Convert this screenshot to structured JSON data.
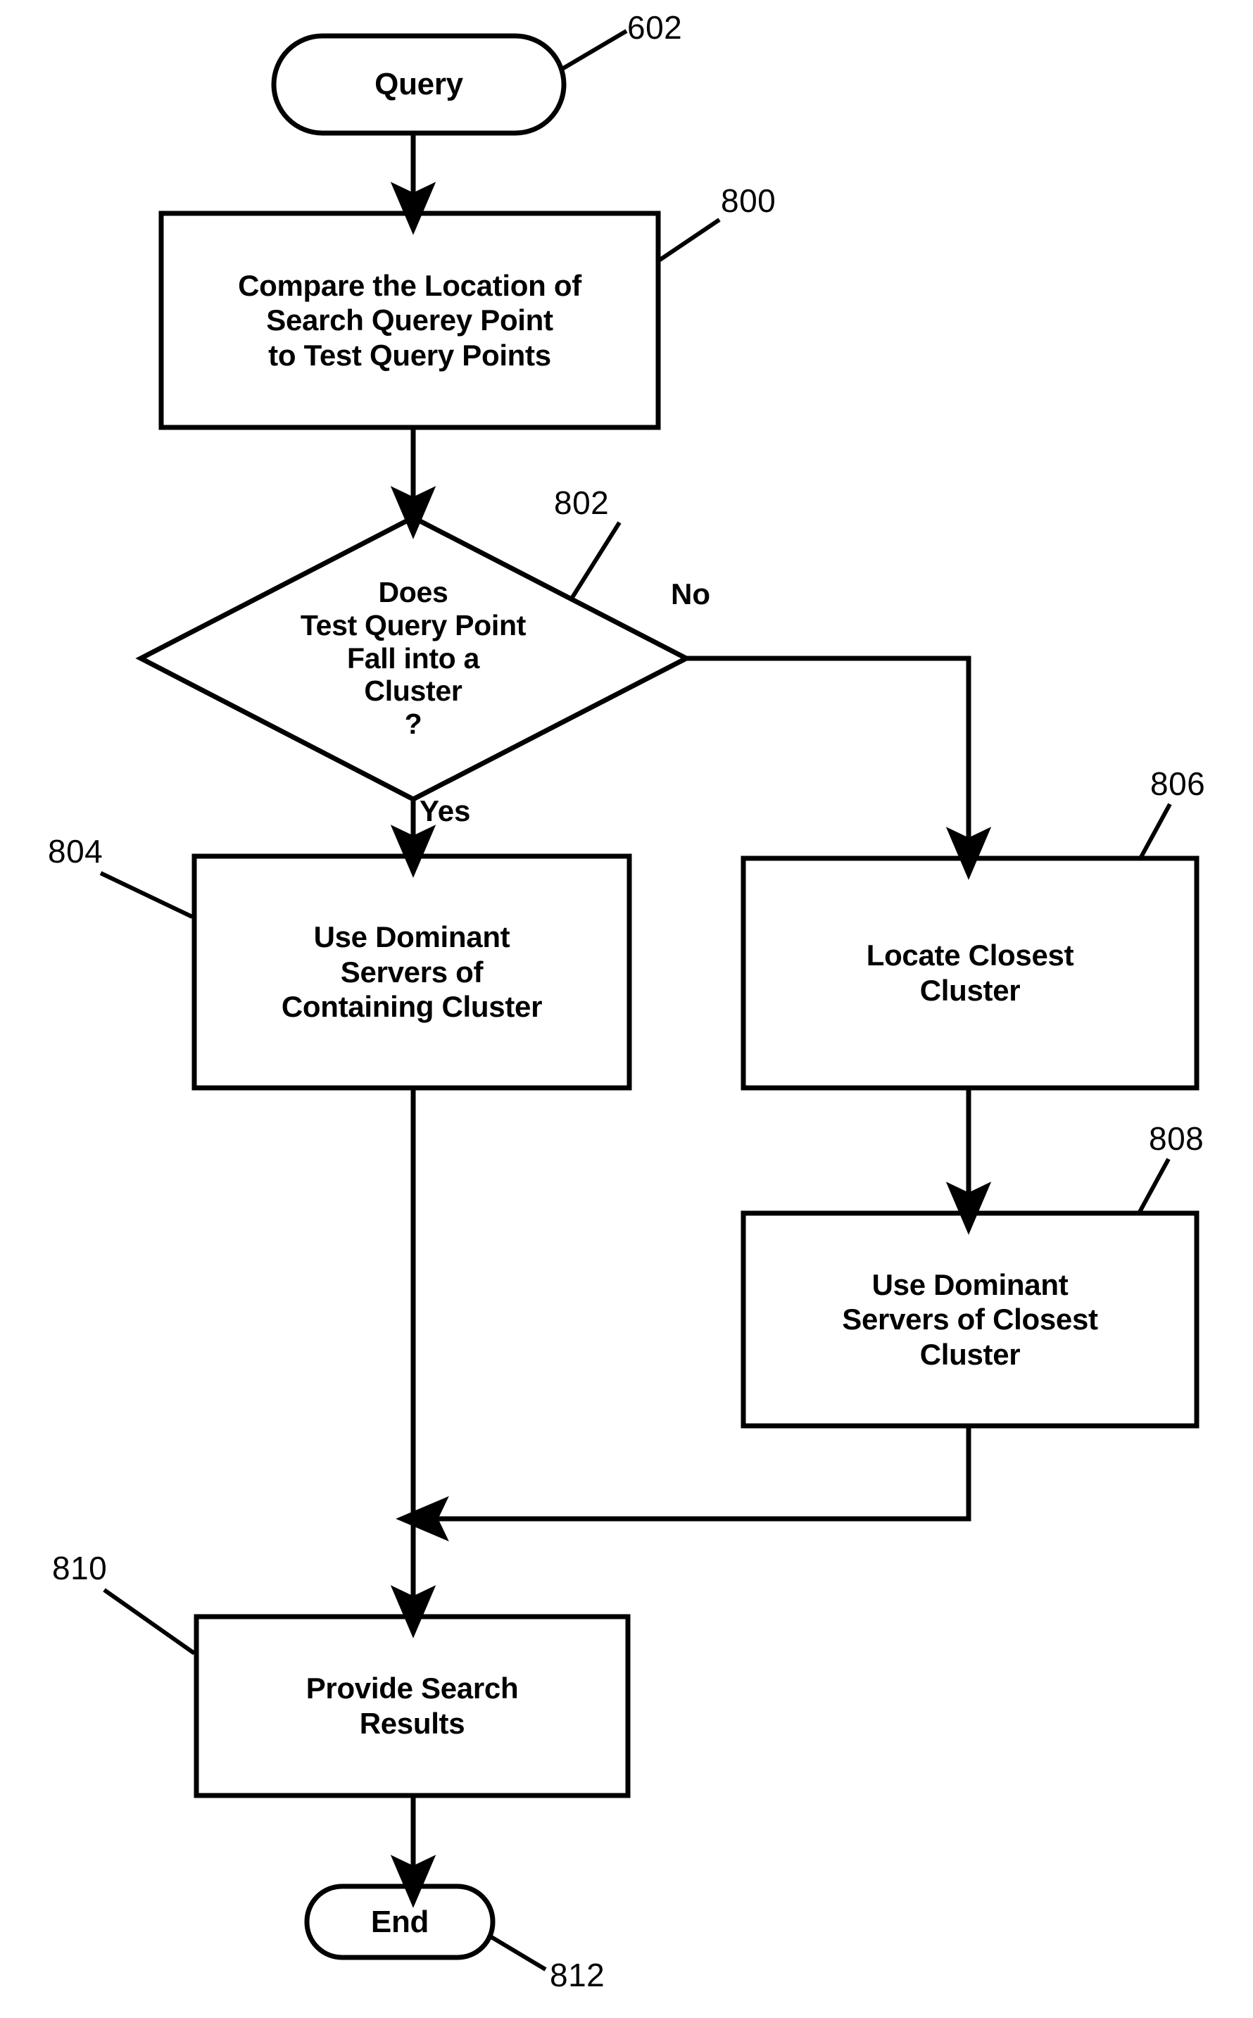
{
  "figure": {
    "type": "patent-flowchart",
    "background_color": "#ffffff",
    "line_color": "#000000"
  },
  "nodes": {
    "start": {
      "id": "602",
      "shape": "terminator",
      "label": "Query"
    },
    "compare": {
      "id": "800",
      "shape": "process",
      "label": "Compare the Location of\nSearch Querey Point\nto Test Query Points"
    },
    "decision": {
      "id": "802",
      "shape": "decision",
      "label": "Does\nTest Query Point\nFall into a\nCluster\n?"
    },
    "use_containing": {
      "id": "804",
      "shape": "process",
      "label": "Use Dominant\nServers of\nContaining Cluster"
    },
    "locate_closest": {
      "id": "806",
      "shape": "process",
      "label": "Locate Closest\nCluster"
    },
    "use_closest": {
      "id": "808",
      "shape": "process",
      "label": "Use Dominant\nServers of Closest\nCluster"
    },
    "provide_results": {
      "id": "810",
      "shape": "process",
      "label": "Provide Search\nResults"
    },
    "end": {
      "id": "812",
      "shape": "terminator",
      "label": "End"
    }
  },
  "edge_labels": {
    "no_branch": "No",
    "yes_branch": "Yes"
  },
  "reference_numerals": {
    "start": "602",
    "compare": "800",
    "decision": "802",
    "use_containing": "804",
    "locate_closest": "806",
    "use_closest": "808",
    "provide_results": "810",
    "end": "812"
  }
}
